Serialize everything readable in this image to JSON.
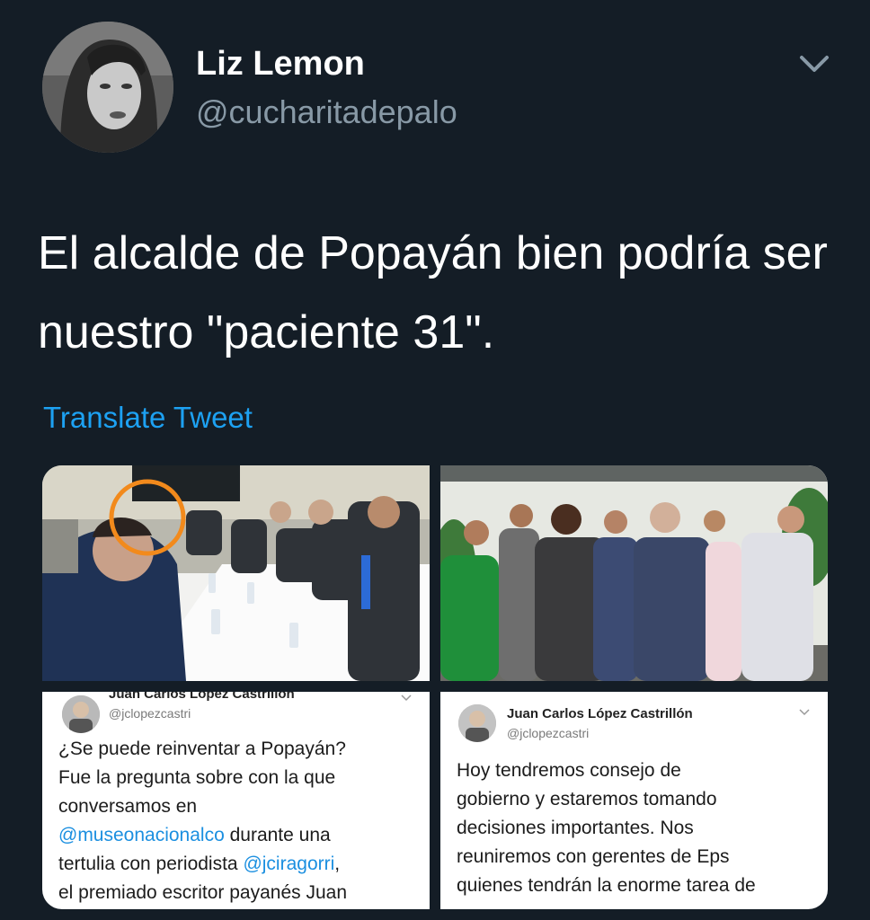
{
  "author": {
    "name": "Liz Lemon",
    "handle": "@cucharitadepalo"
  },
  "tweet": {
    "text": "El alcalde de Popayán bien podría ser nuestro \"paciente 31\".",
    "translate_label": "Translate Tweet",
    "menu_icon": "chevron-down-icon"
  },
  "media": {
    "embedded_tweet_1": {
      "name": "Juan Carlos López Castrillón",
      "handle": "@jclopezcastri",
      "line1": "¿Se puede reinventar a Popayán?",
      "line2": "Fue la pregunta sobre con la que",
      "line3": "conversamos en",
      "mention1": "@museonacionalco",
      "line4_rest": " durante una",
      "line5_start": "tertulia con periodista ",
      "mention2": "@jciragorri",
      "line5_end": ",",
      "line6": "el premiado escritor payanés Juan"
    },
    "embedded_tweet_2": {
      "name": "Juan Carlos López Castrillón",
      "handle": "@jclopezcastri",
      "line1": "Hoy tendremos consejo de",
      "line2": "gobierno y estaremos tomando",
      "line3": "decisiones importantes. Nos",
      "line4": "reuniremos con gerentes de Eps",
      "line5": "quienes tendrán la enorme tarea de"
    }
  },
  "colors": {
    "background": "#141d26",
    "link": "#1da1f2",
    "secondary_text": "#8899a6",
    "highlight_circle": "#f28a1c"
  }
}
